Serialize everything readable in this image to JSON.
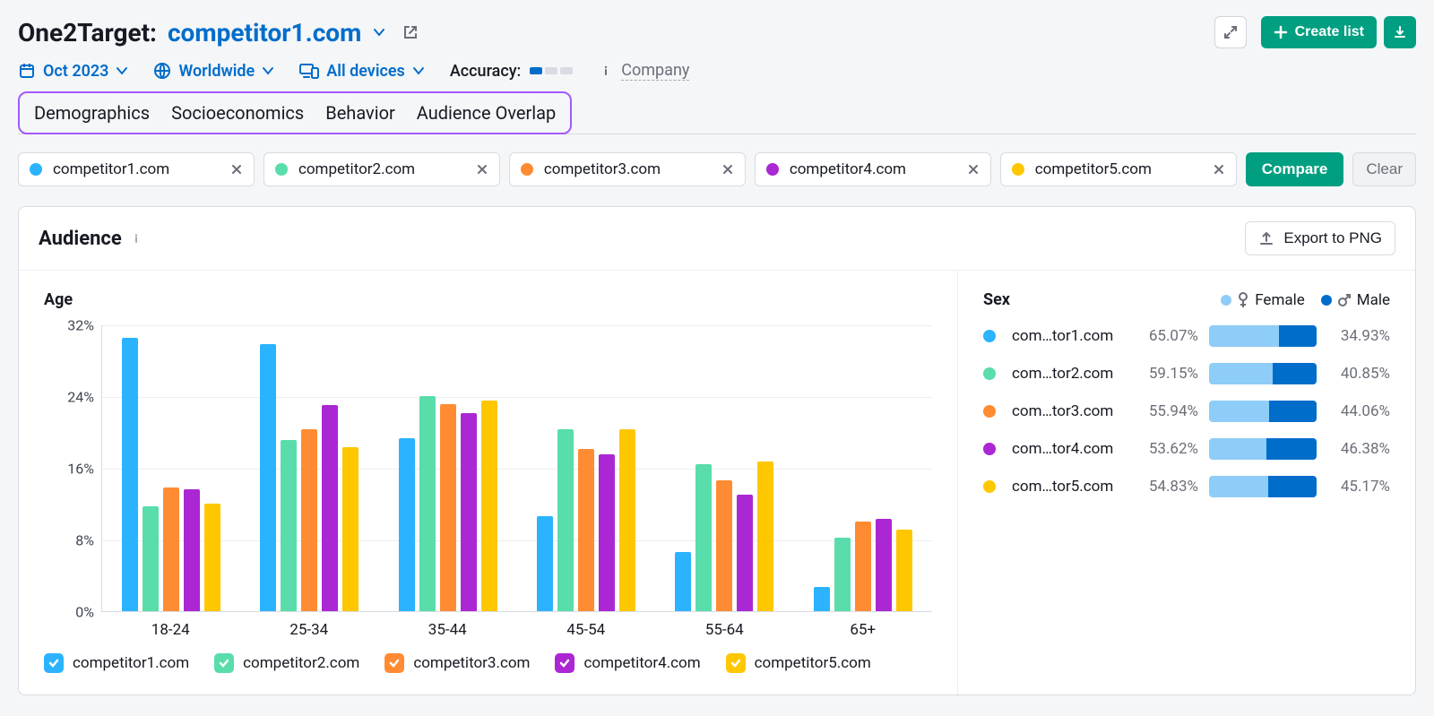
{
  "header": {
    "tool": "One2Target:",
    "domain": "competitor1.com",
    "create_list": "Create list"
  },
  "filters": {
    "date": "Oct 2023",
    "region": "Worldwide",
    "device": "All devices",
    "accuracy_label": "Accuracy:",
    "company_label": "Company"
  },
  "tabs": [
    "Demographics",
    "Socioeconomics",
    "Behavior",
    "Audience Overlap"
  ],
  "competitors": [
    {
      "label": "competitor1.com",
      "short": "com…tor1.com",
      "color": "#2bb3ff"
    },
    {
      "label": "competitor2.com",
      "short": "com…tor2.com",
      "color": "#59ddaa"
    },
    {
      "label": "competitor3.com",
      "short": "com…tor3.com",
      "color": "#ff8c33"
    },
    {
      "label": "competitor4.com",
      "short": "com…tor4.com",
      "color": "#ab27d3"
    },
    {
      "label": "competitor5.com",
      "short": "com…tor5.com",
      "color": "#ffc700"
    }
  ],
  "buttons": {
    "compare": "Compare",
    "clear": "Clear"
  },
  "panel": {
    "title": "Audience",
    "export": "Export to PNG",
    "age_title": "Age",
    "sex_title": "Sex",
    "sex_legend": {
      "female": "Female",
      "male": "Male"
    },
    "colors": {
      "female_light": "#8ecdf7",
      "male_dark": "#006dca"
    }
  },
  "chart_data": {
    "type": "bar",
    "title": "",
    "xlabel": "",
    "ylabel": "",
    "ylim": [
      0,
      32
    ],
    "yticks": [
      "0%",
      "8%",
      "16%",
      "24%",
      "32%"
    ],
    "categories": [
      "18-24",
      "25-34",
      "35-44",
      "45-54",
      "55-64",
      "65+"
    ],
    "series": [
      {
        "name": "competitor1.com",
        "color": "#2bb3ff",
        "values": [
          30.5,
          29.8,
          19.3,
          10.6,
          6.6,
          2.7
        ]
      },
      {
        "name": "competitor2.com",
        "color": "#59ddaa",
        "values": [
          11.7,
          19.1,
          24.0,
          20.3,
          16.4,
          8.2
        ]
      },
      {
        "name": "competitor3.com",
        "color": "#ff8c33",
        "values": [
          13.8,
          20.3,
          23.1,
          18.1,
          14.6,
          10.0
        ]
      },
      {
        "name": "competitor4.com",
        "color": "#ab27d3",
        "values": [
          13.6,
          23.0,
          22.1,
          17.5,
          13.0,
          10.3
        ]
      },
      {
        "name": "competitor5.com",
        "color": "#ffc700",
        "values": [
          12.0,
          18.3,
          23.5,
          20.3,
          16.7,
          9.1
        ]
      }
    ]
  },
  "sex_data": [
    {
      "female": 65.07,
      "male": 34.93
    },
    {
      "female": 59.15,
      "male": 40.85
    },
    {
      "female": 55.94,
      "male": 44.06
    },
    {
      "female": 53.62,
      "male": 46.38
    },
    {
      "female": 54.83,
      "male": 45.17
    }
  ]
}
